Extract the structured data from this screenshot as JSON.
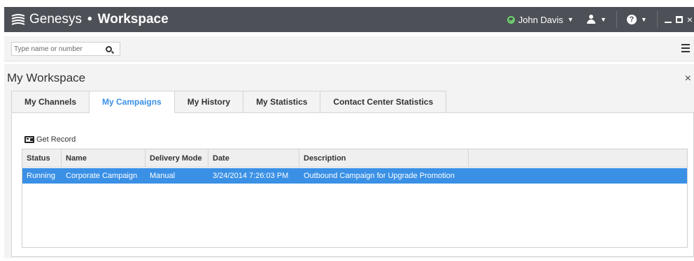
{
  "titlebar": {
    "brand": "Genesys",
    "separator": "•",
    "app": "Workspace",
    "user": "John Davis",
    "caret": "▼",
    "help_glyph": "?",
    "close_glyph": "×"
  },
  "search": {
    "placeholder": "Type name or number"
  },
  "workspace": {
    "title": "My Workspace",
    "close_glyph": "×",
    "tabs": [
      {
        "label": "My Channels"
      },
      {
        "label": "My Campaigns"
      },
      {
        "label": "My History"
      },
      {
        "label": "My Statistics"
      },
      {
        "label": "Contact Center Statistics"
      }
    ],
    "active_tab": "My Campaigns",
    "get_record_label": "Get Record",
    "columns": [
      "Status",
      "Name",
      "Delivery Mode",
      "Date",
      "Description"
    ],
    "rows": [
      {
        "status": "Running",
        "name": "Corporate Campaign",
        "delivery_mode": "Manual",
        "date": "3/24/2014 7:26:03 PM",
        "description": "Outbound Campaign for Upgrade Promotion"
      }
    ]
  },
  "colors": {
    "titlebar": "#4d5157",
    "accent": "#3a90e5",
    "status_ready": "#6dd36d"
  },
  "icons": [
    "genesys-logo-icon",
    "status-ready-icon",
    "agent-icon",
    "help-icon",
    "minimize-icon",
    "maximize-icon",
    "close-icon",
    "search-icon",
    "menu-icon",
    "get-record-icon"
  ]
}
